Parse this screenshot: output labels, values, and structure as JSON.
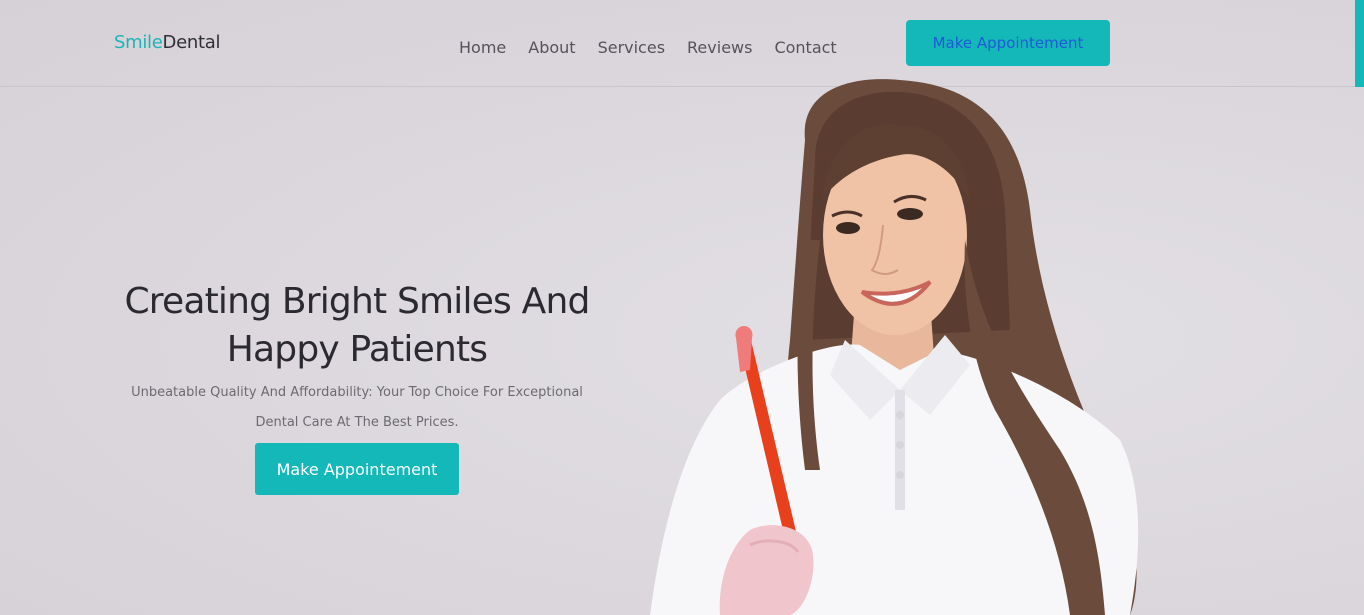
{
  "header": {
    "logo_smile": "Smile",
    "logo_dental": "Dental",
    "nav": [
      "Home",
      "About",
      "Services",
      "Reviews",
      "Contact"
    ],
    "cta_label": "Make Appointement"
  },
  "hero": {
    "title": "Creating Bright Smiles And Happy Patients",
    "subtitle": "Unbeatable Quality And Affordability: Your Top Choice For Exceptional Dental Care At The Best Prices.",
    "cta_label": "Make Appointement"
  },
  "colors": {
    "accent": "#14b8b8",
    "top_button_text": "#1e5bd6",
    "background": "#dcd8de"
  }
}
